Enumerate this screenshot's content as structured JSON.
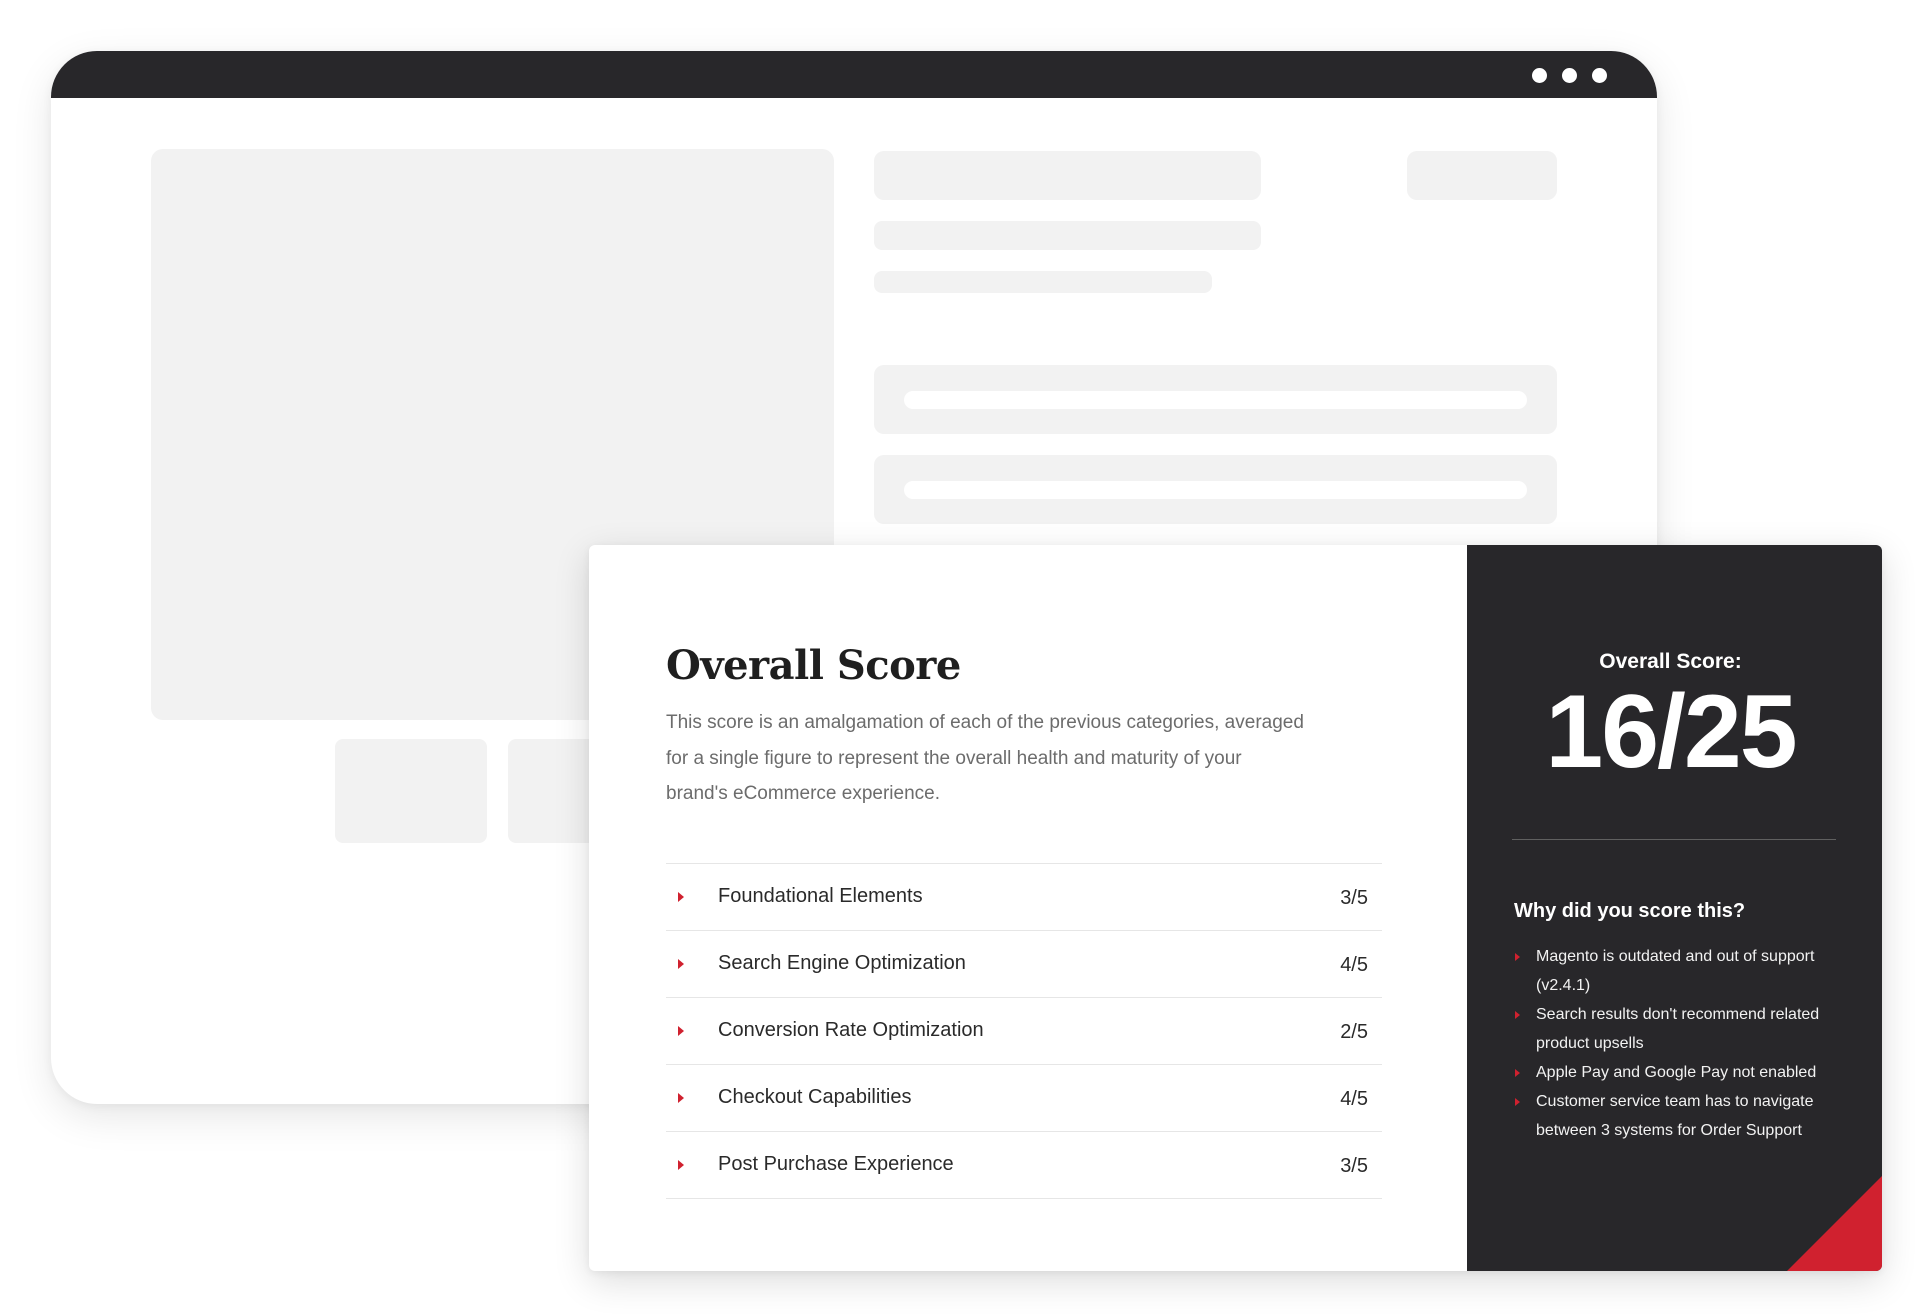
{
  "card": {
    "title": "Overall Score",
    "description": "This score is an amalgamation of each of the previous categories, averaged for a single figure to represent the overall health and maturity of your brand's eCommerce experience.",
    "categories": [
      {
        "label": "Foundational Elements",
        "score": "3/5"
      },
      {
        "label": "Search Engine Optimization",
        "score": "4/5"
      },
      {
        "label": "Conversion Rate Optimization",
        "score": "2/5"
      },
      {
        "label": "Checkout Capabilities",
        "score": "4/5"
      },
      {
        "label": "Post Purchase Experience",
        "score": "3/5"
      }
    ]
  },
  "score_panel": {
    "label": "Overall Score:",
    "value": "16/25",
    "why_title": "Why did you score this?",
    "reasons": [
      "Magento is outdated and out of support (v2.4.1)",
      "Search results don't recommend related product upsells",
      "Apple Pay and Google Pay not enabled",
      "Customer service team has to navigate between 3 systems for Order Support"
    ]
  },
  "colors": {
    "accent": "#d0212f",
    "dark_panel": "#28272a",
    "placeholder": "#f2f2f2",
    "text_primary": "#1f1f1f",
    "text_muted": "#6c6c6c"
  },
  "icons": {
    "window_controls": "three-dots-icon",
    "list_bullet": "caret-right-icon"
  }
}
